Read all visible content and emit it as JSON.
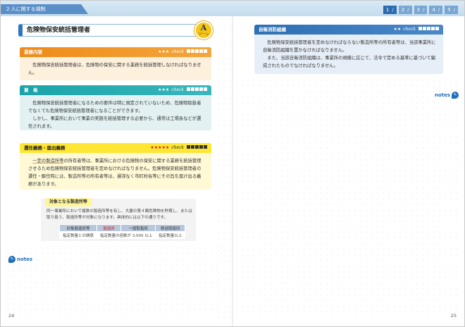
{
  "header": {
    "chapter": "2 人に関する規制",
    "page_nav": [
      {
        "num": "1",
        "sep": "/"
      },
      {
        "num": "2",
        "sep": "/"
      },
      {
        "num": "3",
        "sep": "/"
      },
      {
        "num": "4",
        "sep": "/"
      },
      {
        "num": "5",
        "sep": "/"
      }
    ]
  },
  "left": {
    "title": "危険物保安統括管理者",
    "zone_letter": "A",
    "zone_label": "ゾーン",
    "box1": {
      "head": "業務内容",
      "stars": "★★★",
      "check": "check",
      "body": "危険物保安統括管理者は、危険物の保安に関する業務を統括管理しなければなりません。"
    },
    "box2": {
      "head": "資　格",
      "stars": "★★★",
      "check": "check",
      "body1": "危険物保安統括管理者になるための要件は特に規定されていないため、危険物取扱者でなくても危険物保安統括管理者になることができます。",
      "body2": "しかし、事業所において事業の実施を統括管理する必要から、通常は工場長などが選任されます。"
    },
    "box3": {
      "head": "選任義務・届出義務",
      "stars": "★★★★★",
      "check": "check",
      "body_u": "一定の製造所等",
      "body_rest": "の所有者等は、事業所における危険物の保安に関する業務を統括管理させるため危険物保安統括管理者を定めなければなりません。危険物保安統括管理者の選任・解任時には、製造所等の所有者等は、遅滞なく市町村長等にその旨を届け出る義務があります。"
    },
    "sub": {
      "tag": "対象となる製造所等",
      "text": "同一事業所において複数の製造所等を有し、大量の第４類危険物を貯蔵し、または取り扱う、製造所等が対象になります。具体的には以下の通りです。",
      "table_head": [
        "対象製造所等",
        "製造所",
        "一般取扱所",
        "移送取扱所"
      ],
      "table_row": [
        "指定数量との関係",
        "指定数量の倍数が 3,000 以上",
        "指定数量以上"
      ]
    },
    "notes": "notes",
    "page_number": "24"
  },
  "right": {
    "box": {
      "head": "自衛消防組織",
      "stars": "★★",
      "check": "check",
      "body1": "危険物保安統括管理者を定めなければならない製造所等の所有者等は、当該事業所に自衛消防組織を置かなければなりません。",
      "body2": "また、当該自衛消防組織は、事業所の規模に応じて、法令で定める基準に基づいて編成されたものでなければなりません。"
    },
    "notes": "notes",
    "page_number": "25"
  }
}
